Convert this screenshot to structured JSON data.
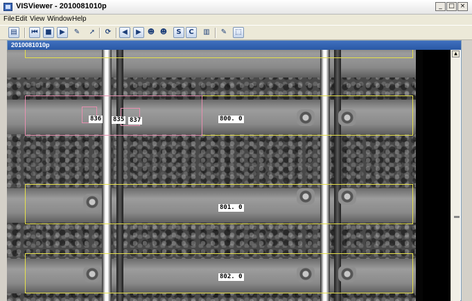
{
  "window": {
    "title": "VISViewer - 2010081010p",
    "min": "_",
    "max": "□",
    "close": "×"
  },
  "menu": [
    "File",
    "Edit",
    "View",
    "Window",
    "Help"
  ],
  "toolbar": {
    "s_label": "S",
    "c_label": "C"
  },
  "document": {
    "title": "2010081010p"
  },
  "scrollbar": {
    "up_arrow": "▲"
  },
  "annotations": {
    "a836": "836",
    "a835": "835",
    "a837": "837",
    "sleeper1": "800. 0",
    "sleeper2": "801. 0",
    "sleeper3": "802. 0"
  }
}
